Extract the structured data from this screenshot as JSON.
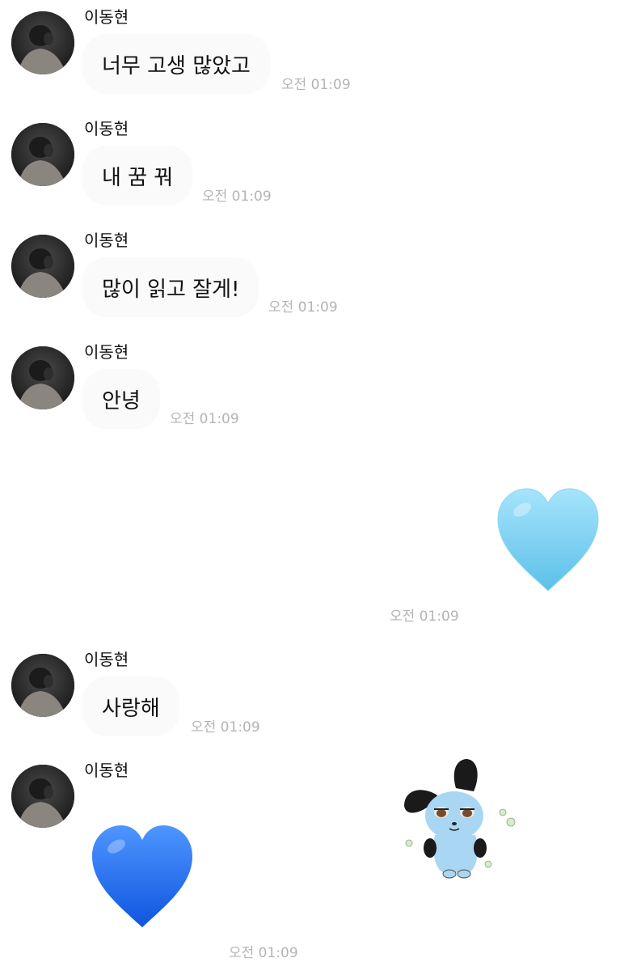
{
  "messages": [
    {
      "sender": "이동현",
      "text": "너무 고생 많았고",
      "time": "오전 01:09"
    },
    {
      "sender": "이동현",
      "text": "내 꿈 꿔",
      "time": "오전 01:09"
    },
    {
      "sender": "이동현",
      "text": "많이 읽고 잘게!",
      "time": "오전 01:09"
    },
    {
      "sender": "이동현",
      "text": "안녕",
      "time": "오전 01:09"
    },
    {
      "outgoing": true,
      "emoji": "light-blue-heart-icon",
      "time": "오전 01:09"
    },
    {
      "sender": "이동현",
      "text": "사랑해",
      "time": "오전 01:09"
    },
    {
      "sender": "이동현",
      "emoji": "blue-heart-icon",
      "sticker": "puppy-sticker",
      "time": "오전 01:09"
    }
  ],
  "colors": {
    "background": "#ffffff",
    "bubble": "#fafafa",
    "timestamp": "#b4b4b4",
    "light_blue_heart": "#7fd2f2",
    "blue_heart": "#1f6ff2"
  }
}
